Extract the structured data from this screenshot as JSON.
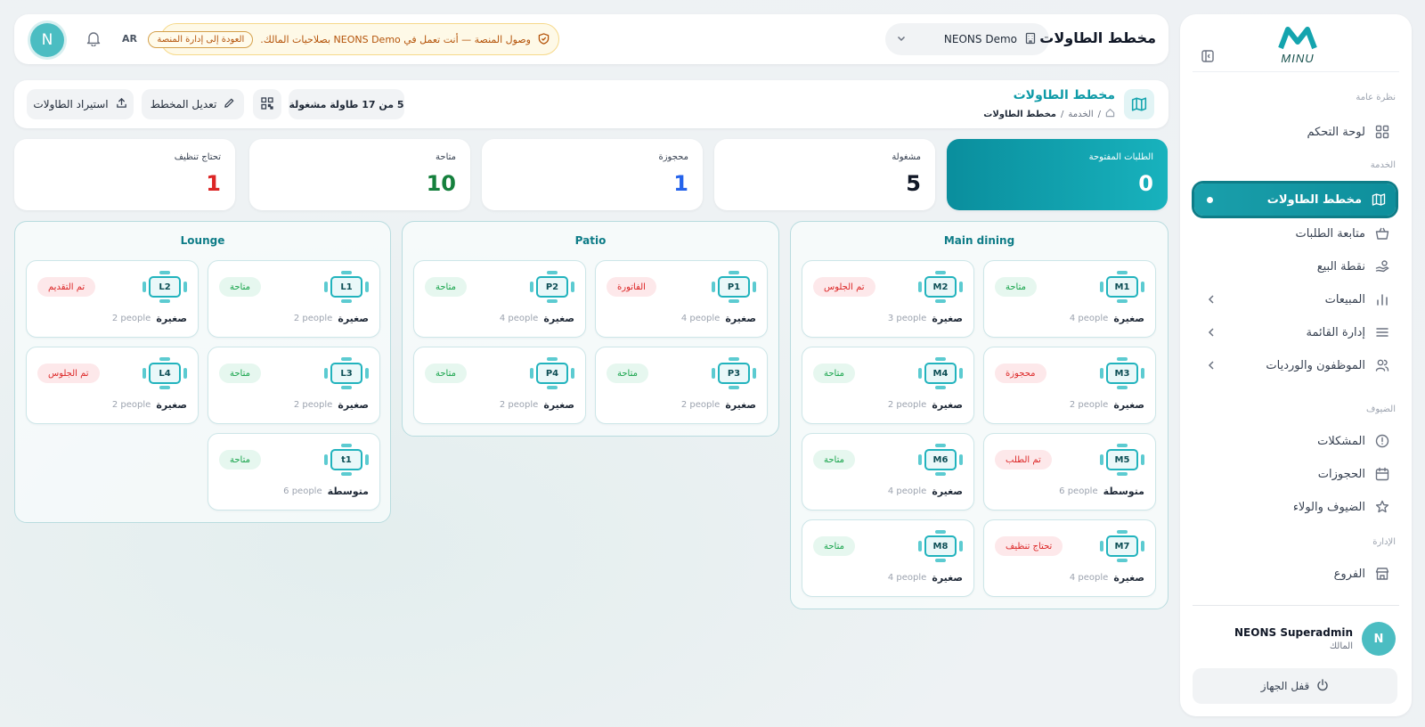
{
  "brand": {
    "logo_text": "MINU",
    "accent": "#16a8b3"
  },
  "sidebar": {
    "sections": {
      "overview": "نظرة عامة",
      "service": "الخدمة",
      "guests": "الضيوف",
      "admin": "الإدارة"
    },
    "items": [
      {
        "label": "لوحة التحكم",
        "icon": "dashboard-icon"
      },
      {
        "label": "مخطط الطاولات",
        "icon": "map-icon",
        "active": true
      },
      {
        "label": "متابعة الطلبات",
        "icon": "basket-icon"
      },
      {
        "label": "نقطة البيع",
        "icon": "hand-coin-icon"
      },
      {
        "label": "المبيعات",
        "icon": "bar-chart-icon",
        "expandable": true
      },
      {
        "label": "إدارة القائمة",
        "icon": "menu-icon",
        "expandable": true
      },
      {
        "label": "الموظفون والورديات",
        "icon": "users-icon",
        "expandable": true
      },
      {
        "label": "المشكلات",
        "icon": "alert-circle-icon"
      },
      {
        "label": "الحجوزات",
        "icon": "calendar-icon"
      },
      {
        "label": "الضيوف والولاء",
        "icon": "star-icon"
      },
      {
        "label": "الفروع",
        "icon": "store-icon"
      }
    ],
    "user": {
      "name": "NEONS Superadmin",
      "role": "المالك",
      "initial": "N"
    },
    "lock_label": "قفل الجهاز"
  },
  "topbar": {
    "avatar_initial": "N",
    "lang": "AR",
    "banner_text": "وصول المنصة — أنت تعمل في NEONS Demo بصلاحيات المالك.",
    "banner_button": "العودة إلى إدارة المنصة",
    "org_name": "NEONS Demo",
    "title": "مخطط الطاولات"
  },
  "header": {
    "title": "مخطط الطاولات",
    "breadcrumb": {
      "parent": "الخدمة",
      "current": "مخطط الطاولات"
    },
    "occupancy": "5 من 17 طاولة مشغولة",
    "edit_label": "تعديل المخطط",
    "import_label": "استيراد الطاولات"
  },
  "stats": {
    "open_orders": {
      "label": "الطلبات المفتوحة",
      "value": "0"
    },
    "occupied": {
      "label": "مشغولة",
      "value": "5",
      "color": "#111827"
    },
    "reserved": {
      "label": "محجوزة",
      "value": "1",
      "color": "#2563eb"
    },
    "available": {
      "label": "متاحة",
      "value": "10",
      "color": "#15803d"
    },
    "cleaning": {
      "label": "تحتاج تنظيف",
      "value": "1",
      "color": "#dc2626"
    }
  },
  "zones": {
    "main": {
      "name": "Main dining",
      "tables": [
        {
          "code": "M1",
          "status": "متاحة",
          "tone": "green",
          "size": "صغيرة",
          "capacity": "4 people"
        },
        {
          "code": "M2",
          "status": "تم الجلوس",
          "tone": "red",
          "size": "صغيرة",
          "capacity": "3 people"
        },
        {
          "code": "M3",
          "status": "محجوزة",
          "tone": "red",
          "size": "صغيرة",
          "capacity": "2 people"
        },
        {
          "code": "M4",
          "status": "متاحة",
          "tone": "green",
          "size": "صغيرة",
          "capacity": "2 people"
        },
        {
          "code": "M5",
          "status": "تم الطلب",
          "tone": "red",
          "size": "متوسطة",
          "capacity": "6 people"
        },
        {
          "code": "M6",
          "status": "متاحة",
          "tone": "green",
          "size": "صغيرة",
          "capacity": "4 people"
        },
        {
          "code": "M7",
          "status": "تحتاج تنظيف",
          "tone": "red",
          "size": "صغيرة",
          "capacity": "4 people"
        },
        {
          "code": "M8",
          "status": "متاحة",
          "tone": "green",
          "size": "صغيرة",
          "capacity": "4 people"
        }
      ]
    },
    "patio": {
      "name": "Patio",
      "tables": [
        {
          "code": "P1",
          "status": "الفاتورة",
          "tone": "red",
          "size": "صغيرة",
          "capacity": "4 people"
        },
        {
          "code": "P2",
          "status": "متاحة",
          "tone": "green",
          "size": "صغيرة",
          "capacity": "4 people"
        },
        {
          "code": "P3",
          "status": "متاحة",
          "tone": "green",
          "size": "صغيرة",
          "capacity": "2 people"
        },
        {
          "code": "P4",
          "status": "متاحة",
          "tone": "green",
          "size": "صغيرة",
          "capacity": "2 people"
        }
      ]
    },
    "lounge": {
      "name": "Lounge",
      "tables": [
        {
          "code": "L1",
          "status": "متاحة",
          "tone": "green",
          "size": "صغيرة",
          "capacity": "2 people"
        },
        {
          "code": "L2",
          "status": "تم التقديم",
          "tone": "red",
          "size": "صغيرة",
          "capacity": "2 people"
        },
        {
          "code": "L3",
          "status": "متاحة",
          "tone": "green",
          "size": "صغيرة",
          "capacity": "2 people"
        },
        {
          "code": "L4",
          "status": "تم الجلوس",
          "tone": "red",
          "size": "صغيرة",
          "capacity": "2 people"
        },
        {
          "code": "t1",
          "status": "متاحة",
          "tone": "green",
          "size": "متوسطة",
          "capacity": "6 people"
        }
      ]
    }
  }
}
